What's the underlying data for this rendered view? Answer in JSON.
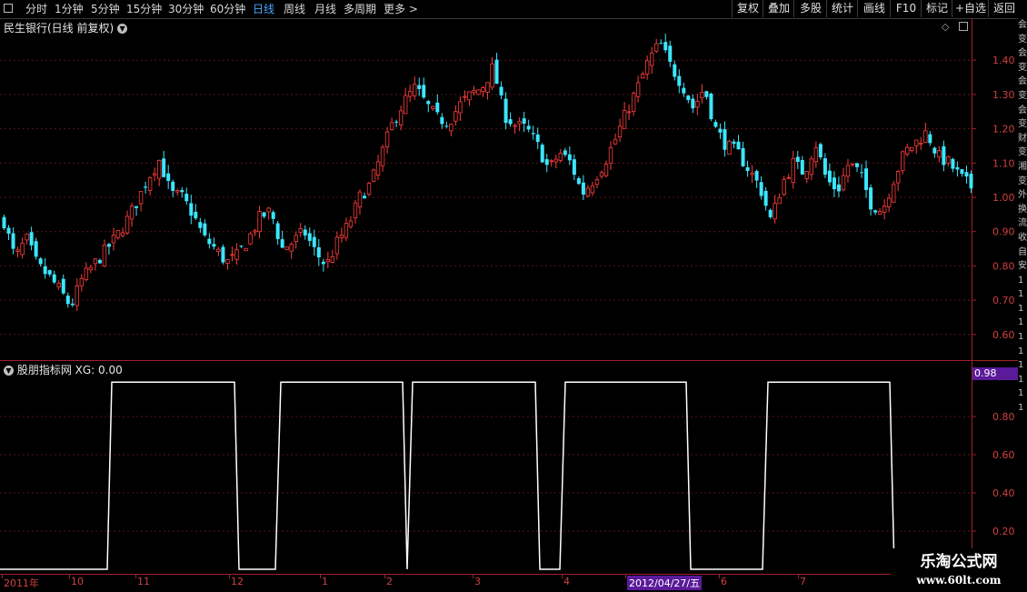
{
  "toolbar": {
    "tabs": [
      "分时",
      "1分钟",
      "5分钟",
      "15分钟",
      "30分钟",
      "60分钟",
      "日线",
      "周线",
      "月线",
      "多周期",
      "更多 >"
    ],
    "active_tab": "日线",
    "right_buttons": [
      "复权",
      "叠加",
      "多股",
      "统计",
      "画线",
      "F10",
      "标记",
      "+自选",
      "返回"
    ]
  },
  "price_panel": {
    "title": "民生银行(日线 前复权)",
    "y_ticks": [
      "1.40",
      "1.30",
      "1.20",
      "1.10",
      "1.00",
      "0.90",
      "0.80",
      "0.70",
      "0.60"
    ]
  },
  "indicator_panel": {
    "title": "股朋指标网 XG: 0.00",
    "current_value": "0.98",
    "y_ticks": [
      "0.80",
      "0.60",
      "0.40",
      "0.20"
    ]
  },
  "date_axis": {
    "labels": [
      "2011年",
      "10",
      "11",
      "12",
      "1",
      "2",
      "3",
      "4",
      "2012/04/27/五",
      "6",
      "7"
    ],
    "highlight": "2012/04/27/五"
  },
  "watermark": {
    "line1": "乐淘公式网",
    "line2": "www.60lt.com"
  },
  "side_strip": [
    "会",
    "变",
    "会",
    "变",
    "会",
    "变",
    "会",
    "变",
    "财",
    "变",
    "湘",
    "变",
    "外",
    "换",
    "流",
    "收",
    "自",
    "安",
    "1",
    "1",
    "1",
    "1",
    "1",
    "1",
    "1",
    "1",
    "1",
    "1"
  ],
  "chart_data": [
    {
      "type": "candlestick",
      "title": "民生银行(日线 前复权)",
      "ylim": [
        0.5,
        1.5
      ],
      "y_ticks": [
        1.4,
        1.3,
        1.2,
        1.1,
        1.0,
        0.9,
        0.8,
        0.7,
        0.6
      ],
      "x_range": [
        "2011-09",
        "2012-08"
      ],
      "up_color": "#ff3c3c",
      "down_color": "#3ce6ff",
      "close_path": [
        [
          0,
          0.93
        ],
        [
          5,
          0.82
        ],
        [
          10,
          0.88
        ],
        [
          15,
          0.8
        ],
        [
          20,
          0.77
        ],
        [
          25,
          0.73
        ],
        [
          30,
          0.68
        ],
        [
          35,
          0.76
        ],
        [
          40,
          0.8
        ],
        [
          45,
          0.84
        ],
        [
          50,
          0.88
        ],
        [
          55,
          0.93
        ],
        [
          60,
          0.99
        ],
        [
          65,
          1.06
        ],
        [
          70,
          1.11
        ],
        [
          75,
          1.01
        ],
        [
          80,
          1.0
        ],
        [
          85,
          0.95
        ],
        [
          90,
          0.88
        ],
        [
          95,
          0.85
        ],
        [
          100,
          0.81
        ],
        [
          105,
          0.83
        ],
        [
          110,
          0.88
        ],
        [
          115,
          0.94
        ],
        [
          120,
          0.96
        ],
        [
          125,
          0.85
        ],
        [
          130,
          0.87
        ],
        [
          135,
          0.9
        ],
        [
          140,
          0.84
        ],
        [
          145,
          0.8
        ],
        [
          150,
          0.87
        ],
        [
          155,
          0.92
        ],
        [
          160,
          1.0
        ],
        [
          165,
          1.04
        ],
        [
          170,
          1.13
        ],
        [
          175,
          1.22
        ],
        [
          180,
          1.28
        ],
        [
          185,
          1.32
        ],
        [
          190,
          1.27
        ],
        [
          195,
          1.23
        ],
        [
          200,
          1.22
        ],
        [
          205,
          1.27
        ],
        [
          210,
          1.3
        ],
        [
          215,
          1.32
        ],
        [
          220,
          1.38
        ],
        [
          225,
          1.24
        ],
        [
          230,
          1.21
        ],
        [
          235,
          1.2
        ],
        [
          240,
          1.15
        ],
        [
          245,
          1.08
        ],
        [
          250,
          1.13
        ],
        [
          255,
          1.1
        ],
        [
          260,
          1.01
        ],
        [
          265,
          1.05
        ],
        [
          270,
          1.1
        ],
        [
          275,
          1.17
        ],
        [
          280,
          1.25
        ],
        [
          285,
          1.32
        ],
        [
          290,
          1.4
        ],
        [
          295,
          1.45
        ],
        [
          300,
          1.38
        ],
        [
          305,
          1.33
        ],
        [
          310,
          1.26
        ],
        [
          315,
          1.32
        ],
        [
          320,
          1.2
        ],
        [
          325,
          1.15
        ],
        [
          330,
          1.13
        ],
        [
          335,
          1.08
        ],
        [
          340,
          1.03
        ],
        [
          345,
          0.93
        ],
        [
          350,
          1.04
        ],
        [
          355,
          1.1
        ],
        [
          360,
          1.07
        ],
        [
          365,
          1.16
        ],
        [
          370,
          1.05
        ],
        [
          375,
          1.02
        ],
        [
          380,
          1.1
        ],
        [
          385,
          1.07
        ],
        [
          390,
          0.98
        ],
        [
          395,
          0.96
        ],
        [
          400,
          1.05
        ],
        [
          405,
          1.13
        ],
        [
          410,
          1.16
        ],
        [
          415,
          1.19
        ],
        [
          420,
          1.12
        ],
        [
          425,
          1.1
        ],
        [
          430,
          1.06
        ],
        [
          435,
          1.03
        ]
      ]
    },
    {
      "type": "line",
      "title": "股朋指标网 XG",
      "ylim": [
        0,
        1
      ],
      "y_ticks": [
        0.8,
        0.6,
        0.4,
        0.2
      ],
      "series": [
        {
          "name": "XG",
          "color": "#ffffff",
          "segments": [
            {
              "value": 0,
              "from": 0,
              "to": 118
            },
            {
              "value": 0.98,
              "from": 123,
              "to": 258
            },
            {
              "value": 0,
              "from": 263,
              "to": 303
            },
            {
              "value": 0.98,
              "from": 309,
              "to": 443
            },
            {
              "value": 0,
              "from": 448,
              "to": 448
            },
            {
              "value": 0.98,
              "from": 454,
              "to": 589
            },
            {
              "value": 0,
              "from": 594,
              "to": 616
            },
            {
              "value": 0.98,
              "from": 622,
              "to": 755
            },
            {
              "value": 0,
              "from": 760,
              "to": 839
            },
            {
              "value": 0.98,
              "from": 845,
              "to": 979
            },
            {
              "value": 0,
              "from": 984,
              "to": 1069
            }
          ]
        }
      ]
    }
  ]
}
